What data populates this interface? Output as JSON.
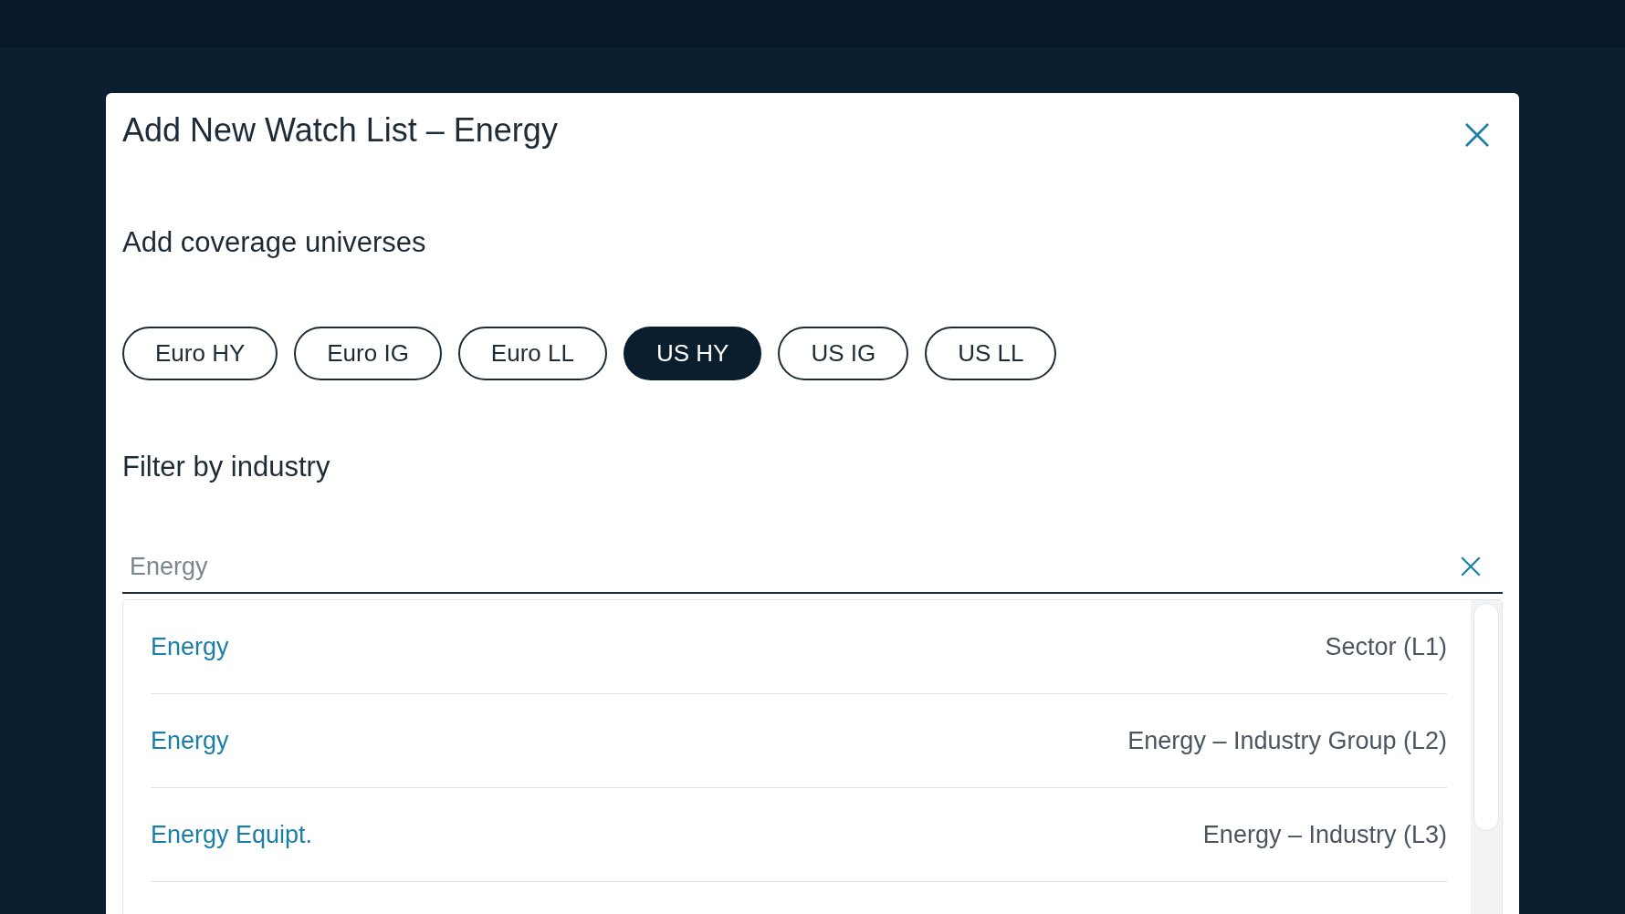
{
  "dialog": {
    "title": "Add New Watch List – Energy"
  },
  "coverage": {
    "heading": "Add coverage universes",
    "chips": [
      {
        "label": "Euro HY",
        "selected": false
      },
      {
        "label": "Euro IG",
        "selected": false
      },
      {
        "label": "Euro LL",
        "selected": false
      },
      {
        "label": "US HY",
        "selected": true
      },
      {
        "label": "US IG",
        "selected": false
      },
      {
        "label": "US LL",
        "selected": false
      }
    ]
  },
  "filter": {
    "heading": "Filter by industry",
    "search": {
      "value": "Energy"
    },
    "results": [
      {
        "name": "Energy",
        "level": "Sector (L1)"
      },
      {
        "name": "Energy",
        "level": "Energy – Industry Group (L2)"
      },
      {
        "name": "Energy Equipt.",
        "level": "Energy – Industry (L3)"
      }
    ]
  }
}
